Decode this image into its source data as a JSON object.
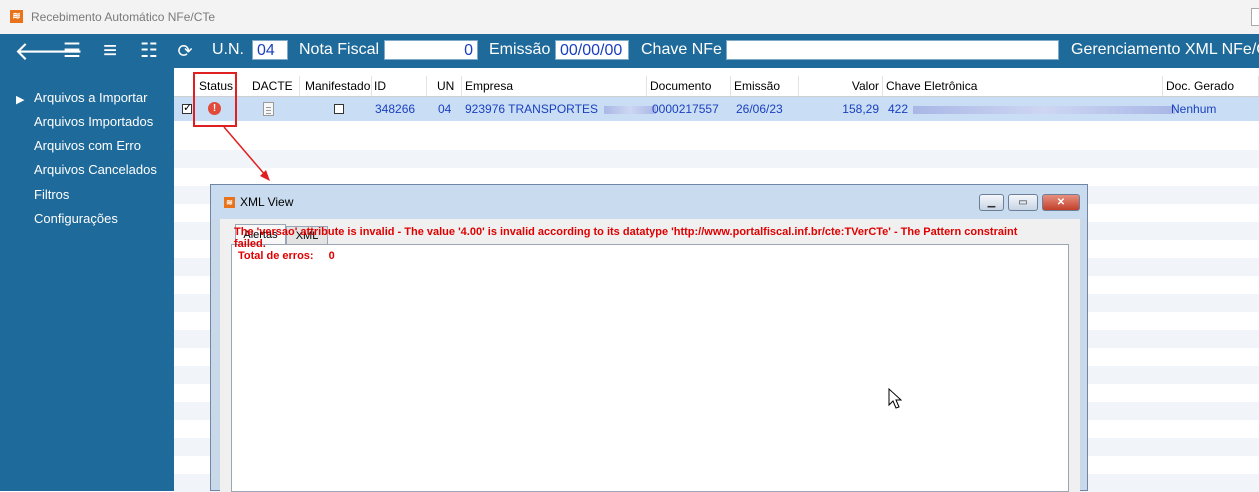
{
  "window": {
    "title": "Recebimento Automático NFe/CTe"
  },
  "toolbar": {
    "un_label": "U.N.",
    "un_value": "04",
    "nota_label": "Nota Fiscal",
    "nota_value": "0",
    "emissao_label": "Emissão",
    "emissao_value": "00/00/00",
    "chave_label": "Chave NFe",
    "chave_value": "",
    "gerenciamento_label": "Gerenciamento XML NFe/C"
  },
  "sidebar": {
    "items": [
      {
        "label": "Arquivos a Importar",
        "active": true
      },
      {
        "label": "Arquivos Importados"
      },
      {
        "label": "Arquivos com Erro"
      },
      {
        "label": "Arquivos Cancelados"
      },
      {
        "label": "Filtros"
      },
      {
        "label": "Configurações"
      }
    ]
  },
  "grid": {
    "headers": [
      "Status",
      "DACTE",
      "Manifestado",
      "ID",
      "UN",
      "Empresa",
      "Documento",
      "Emissão",
      "Valor",
      "Chave Eletrônica",
      "Doc. Gerado"
    ],
    "row": {
      "id": "348266",
      "un": "04",
      "empresa": "923976  TRANSPORTES",
      "documento": "0000217557",
      "emissao": "26/06/23",
      "valor": "158,29",
      "chave": "422",
      "doc_gerado": "Nenhum"
    }
  },
  "dialog": {
    "title": "XML View",
    "tabs": [
      "Alertas",
      "XML"
    ],
    "alert_message": "The 'versao' attribute is invalid - The value '4.00' is invalid according to its datatype 'http://www.portalfiscal.inf.br/cte:TVerCTe' - The Pattern constraint failed.",
    "total_label": "Total de erros:",
    "total_value": "0"
  },
  "colors": {
    "toolbar": "#1e6a9a",
    "selection": "#c9def5",
    "error": "#e00000"
  }
}
